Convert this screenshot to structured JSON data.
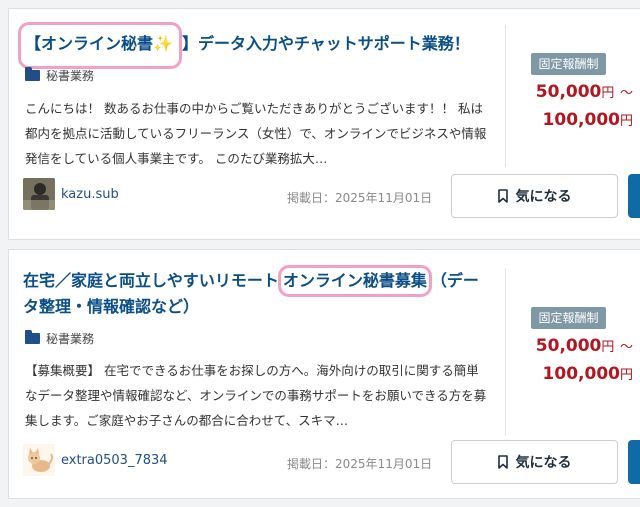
{
  "cards": [
    {
      "title_highlight": "【オンライン秘書✨",
      "title_rest": "】データ入力やチャットサポート業務！",
      "category": "秘書業務",
      "description": "こんにちは！ 数あるお仕事の中からご覧いただきありがとうございます！！ 私は都内を拠点に活動しているフリーランス（女性）で、オンラインでビジネスや情報発信をしている個人事業主です。 このたび業務拡大…",
      "badge": "固定報酬制",
      "price_min": "50,000",
      "price_max": "100,000",
      "price_unit": "円",
      "price_sep": "〜",
      "username": "kazu.sub",
      "date_label": "掲載日：",
      "date": "2025年11月01日",
      "fav_label": "気になる"
    },
    {
      "title_pre": "在宅／家庭と両立しやすいリモート",
      "title_highlight": "オンライン秘書募集",
      "title_rest": "（データ整理・情報確認など）",
      "category": "秘書業務",
      "description": "【募集概要】 在宅でできるお仕事をお探しの方へ。海外向けの取引に関する簡単なデータ整理や情報確認など、オンラインでの事務サポートをお願いできる方を募集します。ご家庭やお子さんの都合に合わせて、スキマ…",
      "badge": "固定報酬制",
      "price_min": "50,000",
      "price_max": "100,000",
      "price_unit": "円",
      "price_sep": "〜",
      "username": "extra0503_7834",
      "date_label": "掲載日：",
      "date": "2025年11月01日",
      "fav_label": "気になる"
    }
  ],
  "colors": {
    "title": "#0a4e87",
    "highlight_border": "#f3a0c7",
    "price": "#b3161f",
    "badge": "#7f98a5",
    "apply_button": "#0f6aa5"
  },
  "icons": {
    "category": "folder-icon",
    "favorite": "bookmark-icon"
  }
}
